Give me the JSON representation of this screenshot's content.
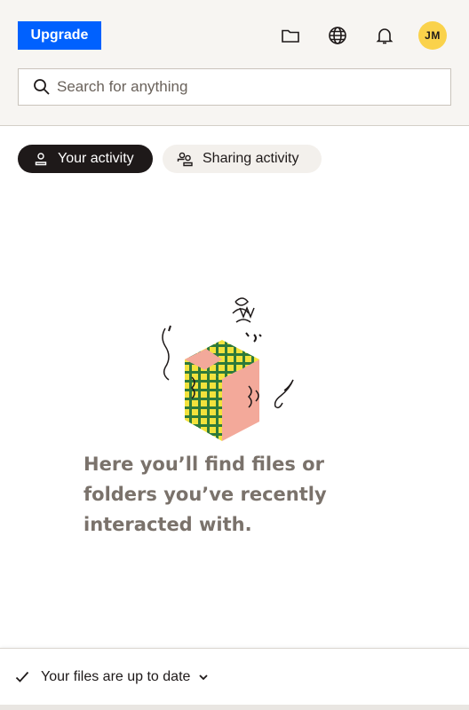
{
  "header": {
    "upgrade_label": "Upgrade",
    "icons": [
      "folder-icon",
      "globe-icon",
      "bell-icon"
    ],
    "avatar_initials": "JM",
    "avatar_color": "#fad24b"
  },
  "search": {
    "placeholder": "Search for anything",
    "value": ""
  },
  "tabs": [
    {
      "label": "Your activity",
      "icon": "person-icon",
      "selected": true
    },
    {
      "label": "Sharing activity",
      "icon": "people-icon",
      "selected": false
    }
  ],
  "empty_state": {
    "message": "Here you’ll find files or folders you’ve recently interacted with."
  },
  "footer": {
    "status": "Your files are up to date"
  },
  "colors": {
    "accent": "#0061fe",
    "dark": "#1e1919",
    "header_bg": "#f7f5f2",
    "muted_text": "#7a726b"
  }
}
